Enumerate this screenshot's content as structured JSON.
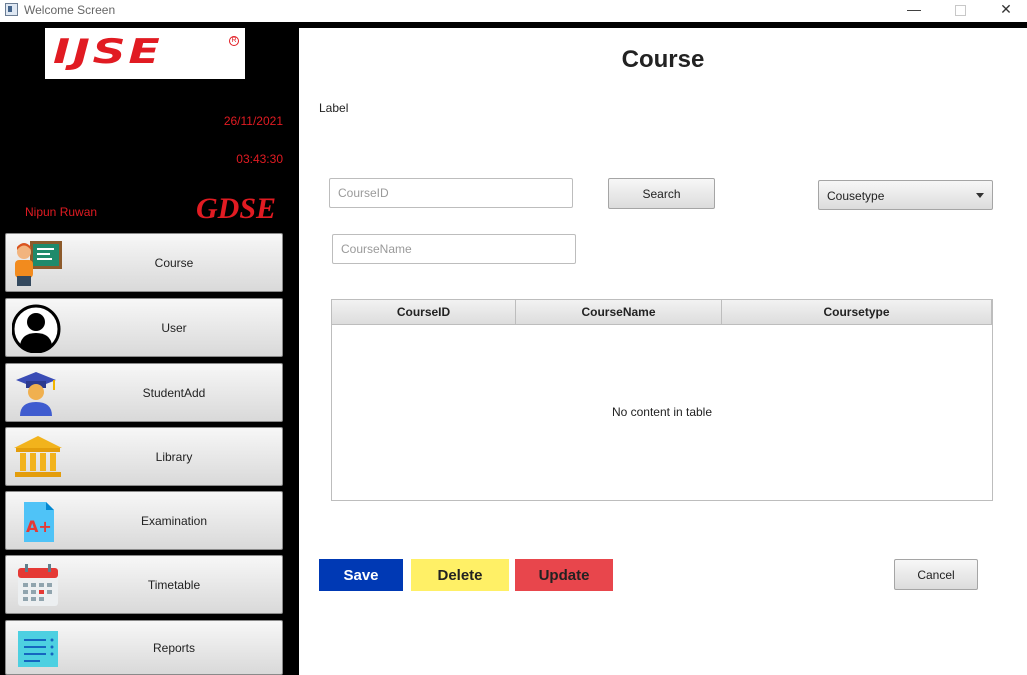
{
  "window": {
    "title": "Welcome Screen",
    "minimize": "—",
    "close": "✕"
  },
  "sidebar": {
    "logo": "IJSE",
    "logo_mark": "R",
    "date": "26/11/2021",
    "time": "03:43:30",
    "user": "Nipun Ruwan",
    "brand": "GDSE",
    "items": [
      {
        "label": "Course",
        "icon": "teacher-icon"
      },
      {
        "label": "User",
        "icon": "user-silhouette-icon"
      },
      {
        "label": "StudentAdd",
        "icon": "graduate-icon"
      },
      {
        "label": "Library",
        "icon": "library-building-icon"
      },
      {
        "label": "Examination",
        "icon": "grade-document-icon"
      },
      {
        "label": "Timetable",
        "icon": "calendar-icon"
      },
      {
        "label": "Reports",
        "icon": "report-list-icon"
      }
    ]
  },
  "main": {
    "title": "Course",
    "label": "Label",
    "course_id_placeholder": "CourseID",
    "course_name_placeholder": "CourseName",
    "search_label": "Search",
    "coursetype_select": "Cousetype",
    "table": {
      "columns": [
        "CourseID",
        "CourseName",
        "Coursetype"
      ],
      "empty": "No content in table"
    },
    "actions": {
      "save": "Save",
      "delete": "Delete",
      "update": "Update",
      "cancel": "Cancel"
    }
  },
  "colors": {
    "save": "#0039b4",
    "delete": "#fff066",
    "update": "#e8464c",
    "brand_red": "#e11b22"
  }
}
